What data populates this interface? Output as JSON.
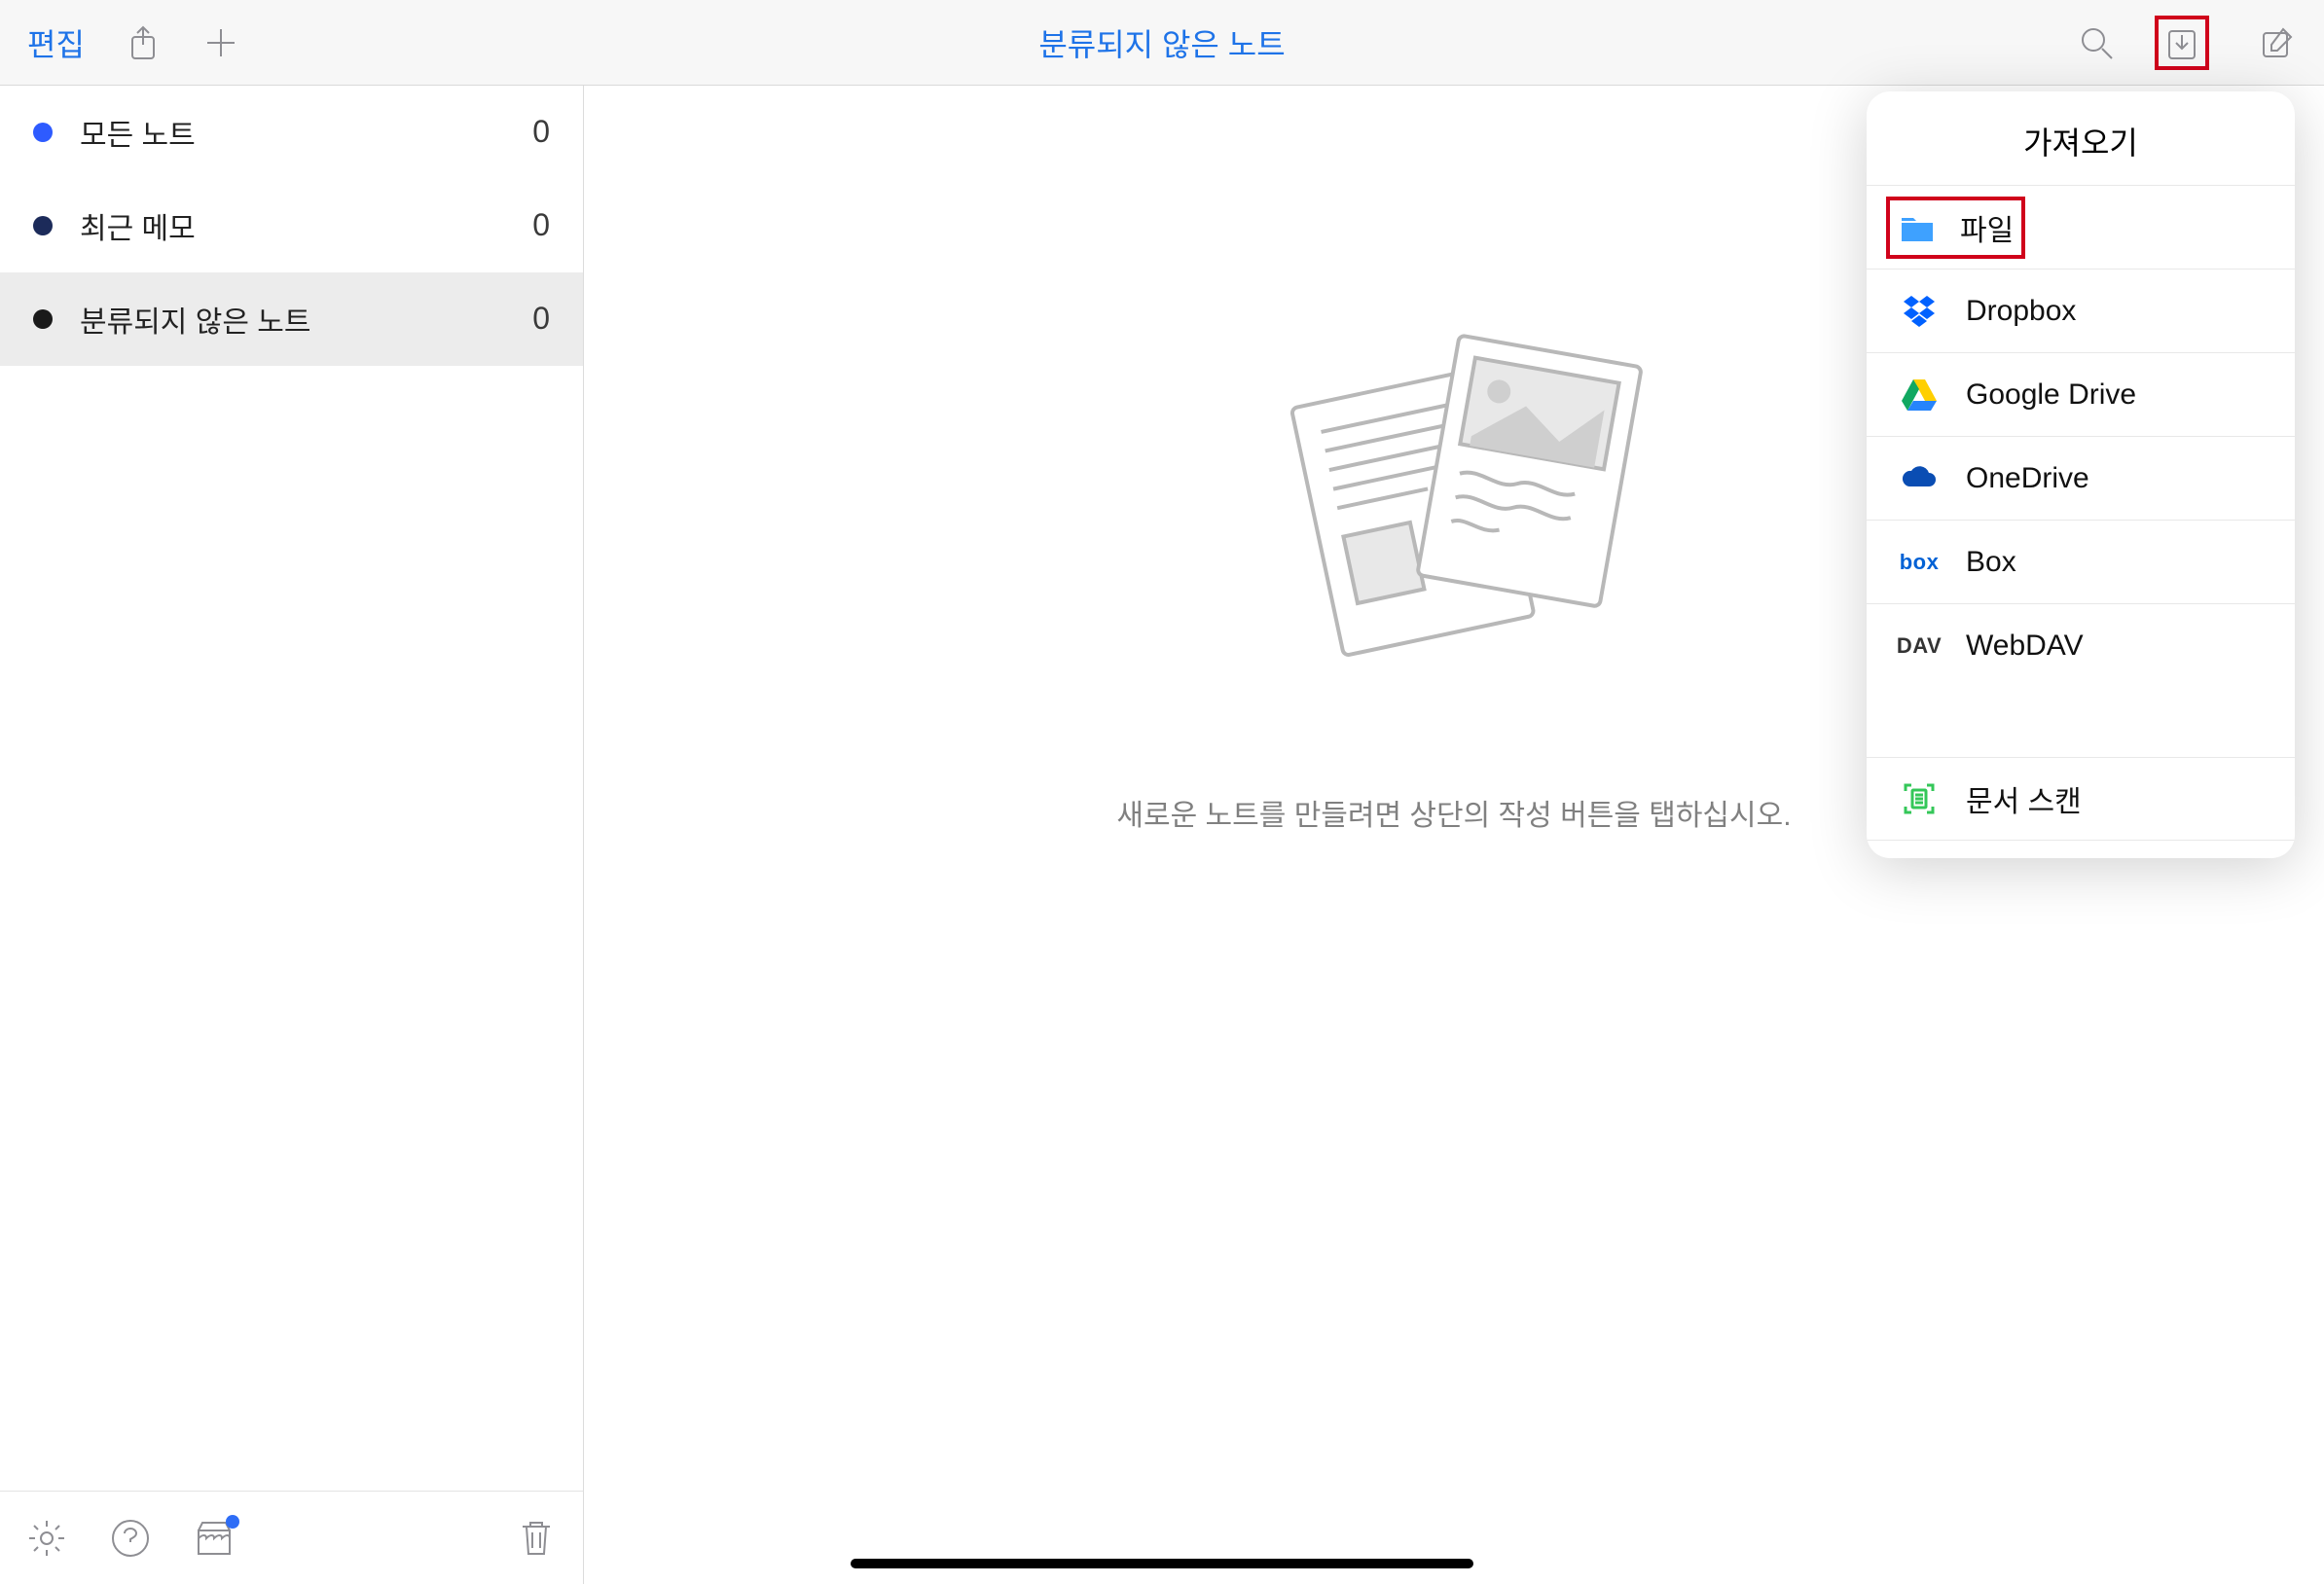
{
  "toolbar": {
    "edit_label": "편집",
    "title": "분류되지 않은 노트"
  },
  "sidebar": {
    "items": [
      {
        "label": "모든 노트",
        "count": "0",
        "color": "blue",
        "selected": false
      },
      {
        "label": "최근 메모",
        "count": "0",
        "color": "navy",
        "selected": false
      },
      {
        "label": "분류되지 않은 노트",
        "count": "0",
        "color": "black",
        "selected": true
      }
    ]
  },
  "main": {
    "empty_text": "새로운 노트를 만들려면 상단의 작성 버튼을 탭하십시오."
  },
  "popover": {
    "title": "가져오기",
    "sources": [
      {
        "label": "파일",
        "icon": "folder",
        "highlighted": true
      },
      {
        "label": "Dropbox",
        "icon": "dropbox"
      },
      {
        "label": "Google Drive",
        "icon": "gdrive"
      },
      {
        "label": "OneDrive",
        "icon": "onedrive"
      },
      {
        "label": "Box",
        "icon": "box"
      },
      {
        "label": "WebDAV",
        "icon": "webdav"
      }
    ],
    "scan": {
      "label": "문서 스캔",
      "icon": "scan"
    }
  }
}
